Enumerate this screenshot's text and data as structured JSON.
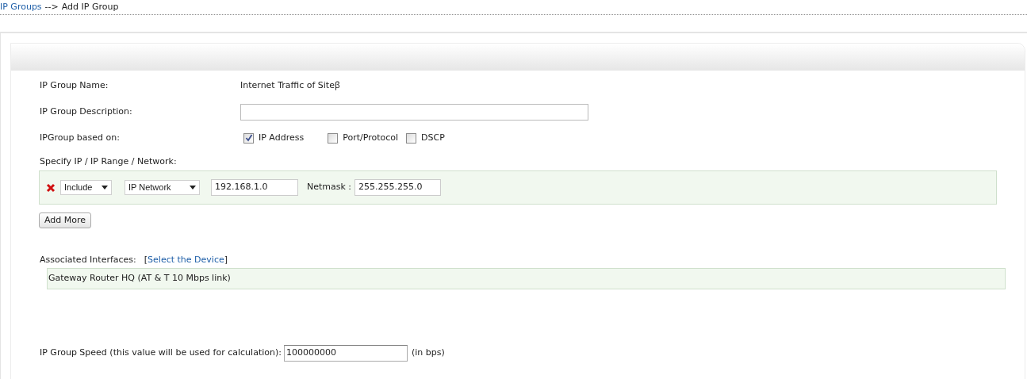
{
  "breadcrumb": {
    "link": "IP Groups",
    "separator": "-->",
    "current": "Add IP Group"
  },
  "form": {
    "name": {
      "label": "IP Group Name:",
      "value": "Internet Traffic of Siteꞵ"
    },
    "description": {
      "label": "IP Group Description:"
    },
    "based_on": {
      "label": "IPGroup based on:",
      "options": [
        {
          "label": "IP Address",
          "checked": true
        },
        {
          "label": "Port/Protocol",
          "checked": false
        },
        {
          "label": "DSCP",
          "checked": false
        }
      ]
    },
    "specify": {
      "label": "Specify IP / IP Range / Network:",
      "rows": [
        {
          "mode": "Include",
          "type": "IP Network",
          "address": "192.168.1.0",
          "mask_label": "Netmask :",
          "mask": "255.255.255.0"
        }
      ]
    },
    "add_more": "Add More",
    "interfaces": {
      "label": "Associated Interfaces:",
      "open_bracket": "[",
      "link": "Select the Device",
      "close_bracket": "]",
      "items": [
        "Gateway Router HQ (AT & T 10 Mbps link)"
      ]
    },
    "speed": {
      "label": "IP Group Speed (this value will be used for calculation):",
      "value": "100000000",
      "unit": "(in bps)"
    }
  }
}
